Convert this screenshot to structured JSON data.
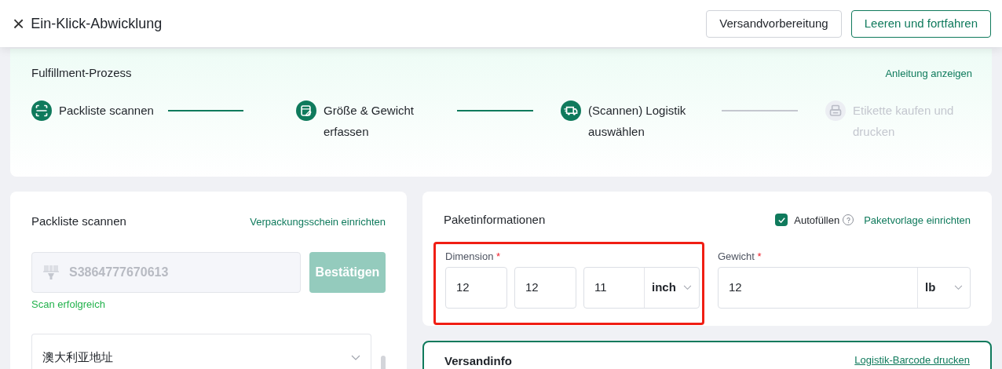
{
  "header": {
    "close_icon": "×",
    "title": "Ein-Klick-Abwicklung",
    "buttons": [
      {
        "label": "Versandvorbereitung",
        "kind": "secondary"
      },
      {
        "label": "Leeren und fortfahren",
        "kind": "outline"
      }
    ]
  },
  "process": {
    "title": "Fulfillment-Prozess",
    "link": "Anleitung anzeigen",
    "steps": [
      {
        "label": "Packliste scannen",
        "done": true
      },
      {
        "label": "Größe & Gewicht erfassen",
        "done": true
      },
      {
        "label": "(Scannen) Logistik auswählen",
        "done": true
      },
      {
        "label": "Etikette kaufen und drucken",
        "done": false
      }
    ]
  },
  "scan_panel": {
    "title": "Packliste scannen",
    "link": "Verpackungsschein einrichten",
    "input_value": "S3864777670613",
    "confirm_button": "Bestätigen",
    "status": "Scan erfolgreich",
    "address": {
      "label": "澳大利亚地址",
      "expanded": false
    }
  },
  "package_panel": {
    "title": "Paketinformationen",
    "autofill": {
      "label": "Autofüllen",
      "checked": true
    },
    "link": "Paketvorlage einrichten",
    "dimension": {
      "label": "Dimension",
      "required": "*",
      "highlighted": true,
      "values": [
        "12",
        "12",
        "11"
      ],
      "unit": "inch"
    },
    "weight": {
      "label": "Gewicht",
      "required": "*",
      "value": "12",
      "unit": "lb"
    }
  },
  "shipping_panel": {
    "title": "Versandinfo",
    "link": "Logistik-Barcode drucken"
  }
}
